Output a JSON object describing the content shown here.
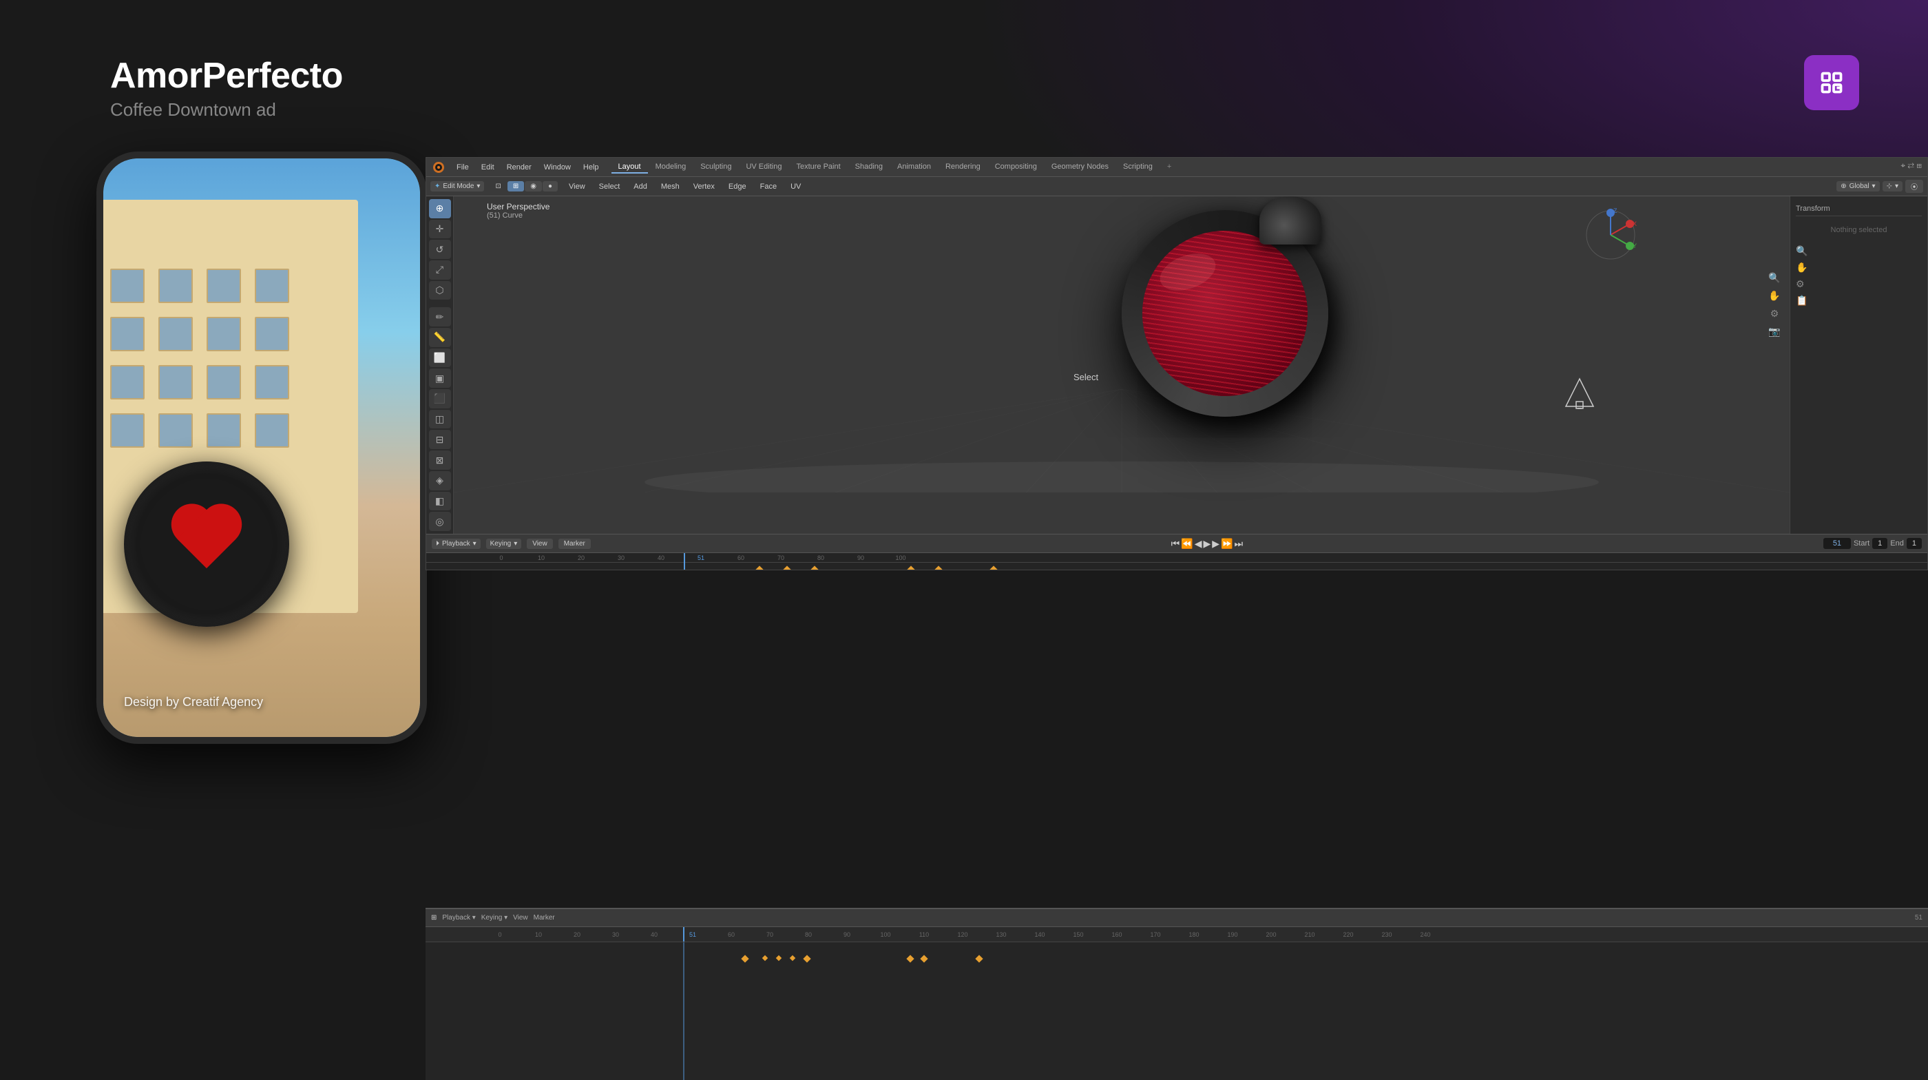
{
  "app": {
    "title": "AmorPerfecto",
    "subtitle": "Coffee Downtown ad"
  },
  "top_right_icon": "dashboard-icon",
  "phone": {
    "bottom_text": "Design by Creatif Agency"
  },
  "blender": {
    "menu": [
      "File",
      "Edit",
      "Render",
      "Window",
      "Help"
    ],
    "workspaces": [
      "Layout",
      "Modeling",
      "Sculpting",
      "UV Editing",
      "Texture Paint",
      "Shading",
      "Animation",
      "Rendering",
      "Compositing",
      "Geometry Nodes",
      "Scripting"
    ],
    "active_workspace": "Layout",
    "viewport_mode": "Edit Mode",
    "viewport_label": "User Perspective",
    "viewport_sublabel": "(51) Curve",
    "toolbar_items": [
      "View",
      "Select",
      "Add",
      "Mesh",
      "Vertex",
      "Edge",
      "Face",
      "UV"
    ],
    "orientation": "Global",
    "transform_panel": {
      "header": "Transform",
      "value": "Nothing selected"
    },
    "timeline": {
      "controls": [
        "Playback",
        "Keying",
        "View",
        "Marker"
      ],
      "current_frame": "51",
      "end_frame": "1",
      "start_label": "Start",
      "end_label": "End",
      "ticks": [
        "0",
        "10",
        "20",
        "30",
        "40",
        "51",
        "60",
        "70",
        "80",
        "90",
        "100",
        "110",
        "120",
        "130",
        "140",
        "150",
        "160",
        "170",
        "180",
        "190",
        "200",
        "210",
        "220",
        "230",
        "240"
      ]
    },
    "select_label": "Select"
  },
  "colors": {
    "accent_purple": "#8b2fc4",
    "blender_bg": "#2b2b2b",
    "blender_toolbar": "#3a3a3a",
    "blender_menu": "#3c3c3c",
    "timeline_bg": "#1e1e1e",
    "playhead": "#5599dd",
    "keyframe": "#e8a030"
  }
}
